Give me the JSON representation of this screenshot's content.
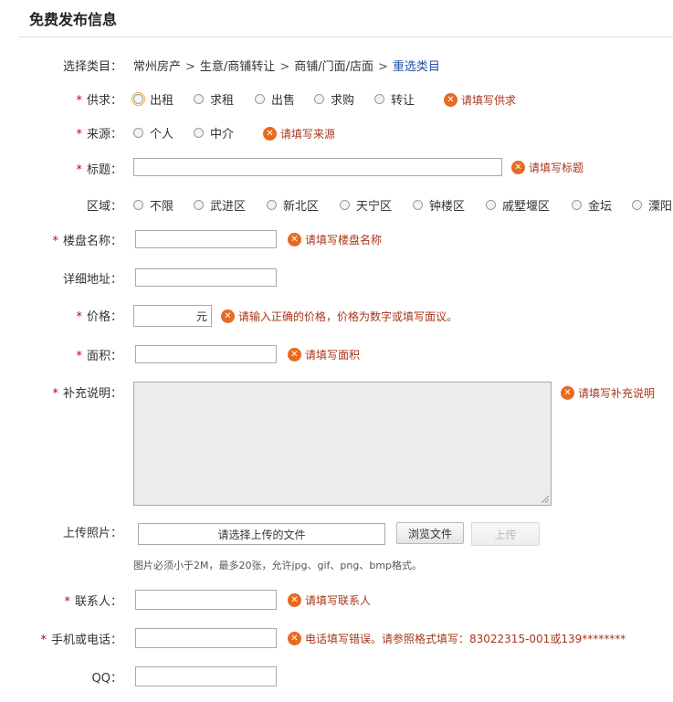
{
  "page_title": "免费发布信息",
  "category": {
    "label": "选择类目：",
    "path": [
      "常州房产",
      "生意/商铺转让",
      "商铺/门面/店面"
    ],
    "separator": ">",
    "reselect": "重选类目"
  },
  "required_mark": "*",
  "supply": {
    "label": "供求：",
    "options": [
      "出租",
      "求租",
      "出售",
      "求购",
      "转让"
    ],
    "error": "请填写供求"
  },
  "source": {
    "label": "来源：",
    "options": [
      "个人",
      "中介"
    ],
    "error": "请填写来源"
  },
  "title_field": {
    "label": "标题：",
    "value": "",
    "error": "请填写标题"
  },
  "district": {
    "label": "区域：",
    "options": [
      "不限",
      "武进区",
      "新北区",
      "天宁区",
      "钟楼区",
      "戚墅堰区",
      "金坛",
      "溧阳"
    ]
  },
  "building": {
    "label": "楼盘名称：",
    "value": "",
    "error": "请填写楼盘名称"
  },
  "address": {
    "label": "详细地址：",
    "value": ""
  },
  "price": {
    "label": "价格：",
    "value": "",
    "unit": "元",
    "error": "请输入正确的价格，价格为数字或填写面议。"
  },
  "area": {
    "label": "面积：",
    "value": "",
    "error": "请填写面积"
  },
  "description": {
    "label": "补充说明：",
    "value": "",
    "error": "请填写补充说明"
  },
  "photos": {
    "label": "上传照片：",
    "file_placeholder": "请选择上传的文件",
    "browse_button": "浏览文件",
    "upload_button": "上传",
    "hint": "图片必须小于2M，最多20张，允许jpg、gif、png、bmp格式。"
  },
  "contact": {
    "label": "联系人：",
    "value": "",
    "error": "请填写联系人"
  },
  "phone": {
    "label": "手机或电话：",
    "value": "",
    "error": "电话填写错误。请参照格式填写：83022315-001或139********"
  },
  "qq": {
    "label": "QQ：",
    "value": ""
  },
  "icons": {
    "error": "error-x-icon"
  },
  "colors": {
    "required": "#cc0000",
    "error_text": "#a8361a",
    "error_icon": "#e86a1f",
    "link": "#1f4fa5"
  }
}
